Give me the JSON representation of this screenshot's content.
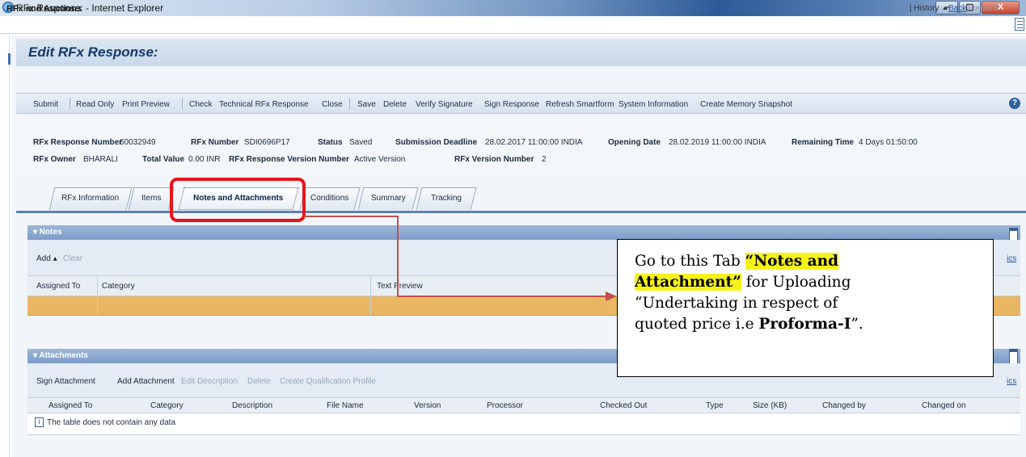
{
  "window": {
    "title": "RFx Response: - Internet Explorer",
    "min": "–",
    "max": "▢",
    "close": "X"
  },
  "appbar": {
    "title": "RFx and Auctions",
    "history": "| History",
    "back": "Back",
    "forward": "Forward"
  },
  "page": {
    "title": "Edit RFx Response:"
  },
  "toolbar": {
    "items": [
      "Submit",
      "Read Only",
      "Print Preview",
      "Check",
      "Technical RFx Response",
      "Close",
      "Save",
      "Delete",
      "Verify Signature",
      "Sign Response",
      "Refresh Smartform",
      "System Information",
      "Create Memory Snapshot"
    ],
    "help": "?"
  },
  "header": {
    "rfx_response_number_label": "RFx Response Number",
    "rfx_response_number": "60032949",
    "rfx_number_label": "RFx Number",
    "rfx_number": "SDI0696P17",
    "status_label": "Status",
    "status": "Saved",
    "submission_deadline_label": "Submission Deadline",
    "submission_deadline": "28.02.2017 11:00:00 INDIA",
    "opening_date_label": "Opening Date",
    "opening_date": "28.02.2019 11:00:00 INDIA",
    "remaining_time_label": "Remaining Time",
    "remaining_time": "4 Days 01:50:00",
    "rfx_owner_label": "RFx Owner",
    "rfx_owner": "BHARALI",
    "total_value_label": "Total Value",
    "total_value": "0.00 INR",
    "version_number_label": "RFx Response Version Number",
    "version_number": "Active Version",
    "rfx_version_label": "RFx Version Number",
    "rfx_version": "2"
  },
  "tabs": [
    "RFx Information",
    "Items",
    "Notes and Attachments",
    "Conditions",
    "Summary",
    "Tracking"
  ],
  "notes": {
    "title": "▾ Notes",
    "add": "Add ▴",
    "clear": "Clear",
    "right_link": "ics",
    "columns": [
      "Assigned To",
      "Category",
      "Text Preview"
    ]
  },
  "attachments": {
    "title": "▾ Attachments",
    "actions": [
      "Sign Attachment",
      "Add Attachment",
      "Edit Description",
      "Delete",
      "Create Qualification Profile"
    ],
    "right_link": "ics",
    "columns": [
      "Assigned To",
      "Category",
      "Description",
      "File Name",
      "Version",
      "Processor",
      "Checked Out",
      "Type",
      "Size (KB)",
      "Changed by",
      "Changed on"
    ],
    "empty_message": "The table does not contain any data",
    "info_icon": "i"
  },
  "callout": {
    "line1_pre": "Go to this Tab ",
    "line1_hl": "“Notes and",
    "line2_hl": "Attachment”",
    "line2_post": " for Uploading",
    "line3": "“Undertaking in respect of",
    "line4_pre": "quoted price i.e ",
    "line4_bold": "Proforma-I",
    "line4_post": "”."
  },
  "colors": {
    "accent": "#5d7fae",
    "highlight_row": "#e9b763",
    "callout_highlight": "#f7f21a",
    "red_frame": "#e8141b",
    "arrow": "#c0504d"
  }
}
